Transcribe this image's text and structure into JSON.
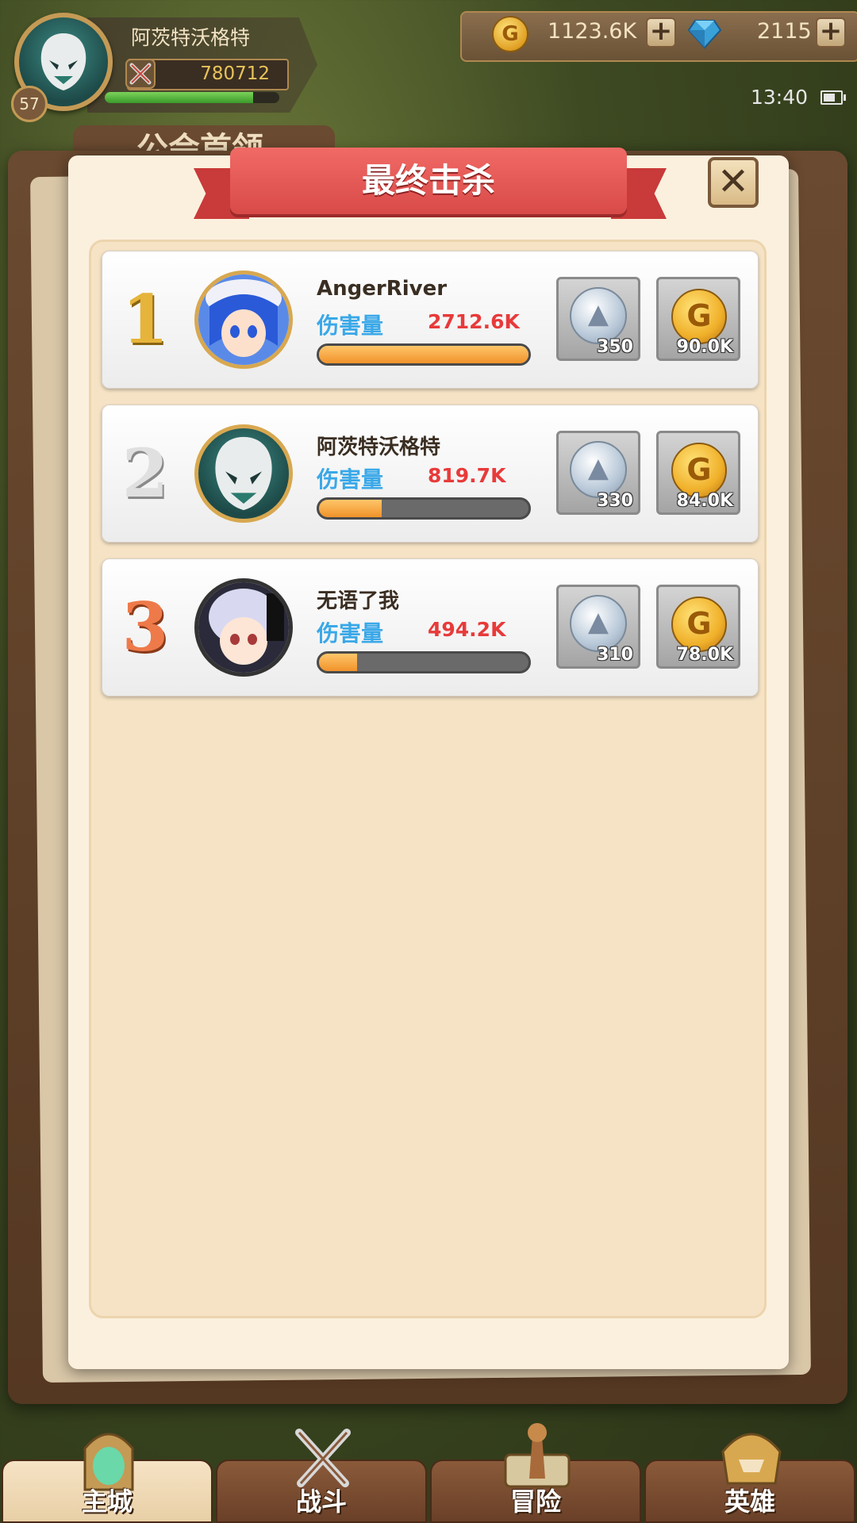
{
  "player": {
    "name": "阿茨特沃格特",
    "level": "57",
    "power": "780712",
    "xp_fraction": 0.85
  },
  "currency": {
    "gold": "1123.6K",
    "gems": "2115",
    "plus_symbol": "+"
  },
  "status_bar": {
    "time": "13:40"
  },
  "background": {
    "tab_label": "公会首领"
  },
  "dialog": {
    "title": "最终击杀",
    "close_symbol": "✕"
  },
  "rankings": [
    {
      "rank": "1",
      "name": "AngerRiver",
      "damage_label": "伤害量",
      "damage": "2712.6K",
      "damage_fraction": 1.0,
      "rewards": {
        "silver": "350",
        "gold": "90.0K"
      }
    },
    {
      "rank": "2",
      "name": "阿茨特沃格特",
      "damage_label": "伤害量",
      "damage": "819.7K",
      "damage_fraction": 0.3,
      "rewards": {
        "silver": "330",
        "gold": "84.0K"
      }
    },
    {
      "rank": "3",
      "name": "无语了我",
      "damage_label": "伤害量",
      "damage": "494.2K",
      "damage_fraction": 0.18,
      "rewards": {
        "silver": "310",
        "gold": "78.0K"
      }
    }
  ],
  "nav": {
    "items": [
      {
        "label": "主城",
        "active": true
      },
      {
        "label": "战斗",
        "active": false
      },
      {
        "label": "冒险",
        "active": false
      },
      {
        "label": "英雄",
        "active": false
      }
    ]
  },
  "colors": {
    "ribbon": "#e85654",
    "damage_label": "#3aa8e8",
    "damage_value": "#e83a3a",
    "bar_fill": "#f0922a"
  },
  "icons": {
    "gold": "gold-coin-icon",
    "gem": "blue-gem-icon",
    "power": "crossed-swords-icon",
    "battery": "battery-icon",
    "close": "close-icon",
    "silver_reward": "silver-coin-icon",
    "gold_reward": "gold-coin-icon"
  }
}
